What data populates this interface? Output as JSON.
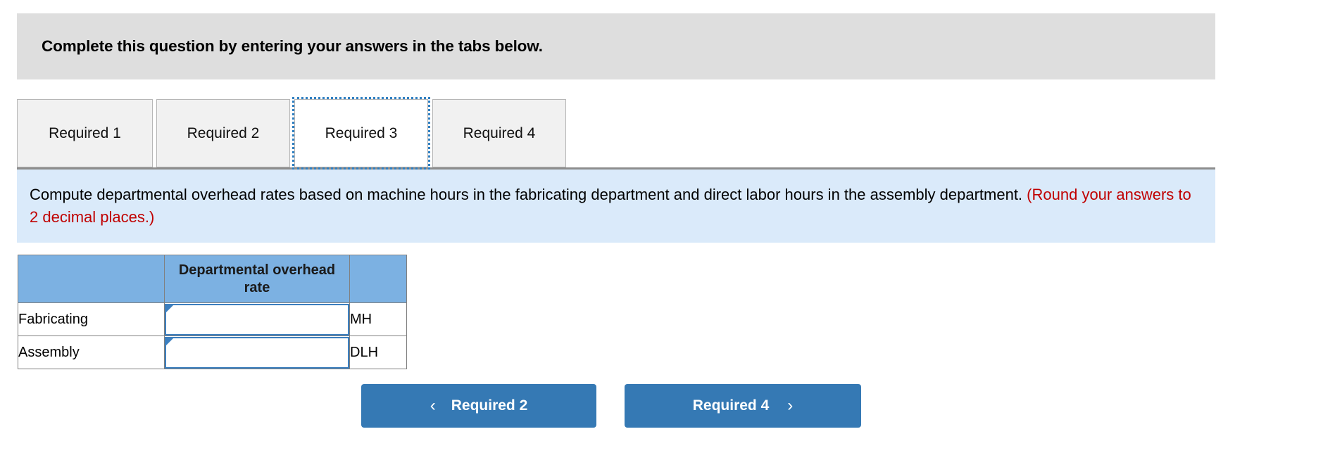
{
  "header": {
    "title": "Complete this question by entering your answers in the tabs below."
  },
  "tabs": [
    {
      "label": "Required 1",
      "active": false
    },
    {
      "label": "Required 2",
      "active": false
    },
    {
      "label": "Required 3",
      "active": true
    },
    {
      "label": "Required 4",
      "active": false
    }
  ],
  "question": {
    "text": "Compute departmental overhead rates based on machine hours in the fabricating department and direct labor hours in the assembly department.",
    "round_note": "(Round your answers to 2 decimal places.)"
  },
  "table": {
    "headers": [
      "",
      "Departmental overhead rate",
      ""
    ],
    "rows": [
      {
        "label": "Fabricating",
        "value": "",
        "unit": "MH"
      },
      {
        "label": "Assembly",
        "value": "",
        "unit": "DLH"
      }
    ]
  },
  "navigation": {
    "prev_label": "Required 2",
    "prev_icon": "chevron-left-icon",
    "prev_chevron": "‹",
    "next_label": "Required 4",
    "next_icon": "chevron-right-icon",
    "next_chevron": "›"
  },
  "colors": {
    "header_bg": "#dedede",
    "question_bg": "#daeafa",
    "question_note": "#c00000",
    "table_header_bg": "#7cb1e2",
    "input_border": "#3c7fbf",
    "button_bg": "#3579b4",
    "tab_bg": "#f1f1f1",
    "focus_outline": "#2f7fc1"
  }
}
